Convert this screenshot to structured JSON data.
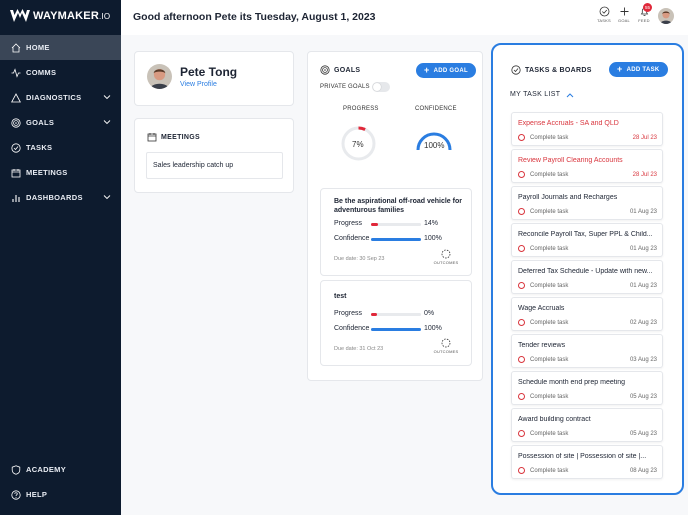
{
  "app": {
    "logo_text": "WAYMAKER",
    "logo_suffix": ".IO"
  },
  "sidebar": {
    "items": [
      {
        "label": "HOME",
        "icon": "home-icon",
        "active": true
      },
      {
        "label": "COMMS",
        "icon": "pulse-icon"
      },
      {
        "label": "DIAGNOSTICS",
        "icon": "triangle-icon",
        "expandable": true
      },
      {
        "label": "GOALS",
        "icon": "target-icon",
        "expandable": true
      },
      {
        "label": "TASKS",
        "icon": "check-circle-icon"
      },
      {
        "label": "MEETINGS",
        "icon": "calendar-icon"
      },
      {
        "label": "DASHBOARDS",
        "icon": "bar-chart-icon",
        "expandable": true
      }
    ],
    "bottom_items": [
      {
        "label": "ACADEMY",
        "icon": "shield-icon"
      },
      {
        "label": "HELP",
        "icon": "help-icon"
      }
    ]
  },
  "header": {
    "greeting": "Good afternoon Pete its Tuesday, August 1, 2023",
    "actions": [
      {
        "label": "TASKS",
        "icon": "task-check-icon"
      },
      {
        "label": "GOAL",
        "icon": "plus-icon"
      },
      {
        "label": "FEED",
        "icon": "bell-icon",
        "badge": "55"
      }
    ]
  },
  "profile": {
    "name": "Pete Tong",
    "link": "View Profile"
  },
  "meetings": {
    "title": "MEETINGS",
    "items": [
      "Sales leadership catch up"
    ]
  },
  "goals": {
    "title": "GOALS",
    "add_label": "ADD GOAL",
    "private_label": "PRIVATE GOALS",
    "progress_label": "PROGRESS",
    "confidence_label": "CONFIDENCE",
    "progress_value": "7%",
    "confidence_value": "100%",
    "progress_fraction": 0.07,
    "confidence_fraction": 1.0,
    "outcomes_label": "OUTCOMES",
    "progress_metric_label": "Progress",
    "confidence_metric_label": "Confidence",
    "items": [
      {
        "title": "Be the aspirational off-road vehicle for adventurous families",
        "progress": "14%",
        "progress_fraction": 0.14,
        "confidence": "100%",
        "confidence_fraction": 1.0,
        "due": "Due date: 30 Sep 23"
      },
      {
        "title": "test",
        "progress": "0%",
        "progress_fraction": 0.0,
        "confidence": "100%",
        "confidence_fraction": 1.0,
        "due": "Due date: 31 Oct 23"
      }
    ]
  },
  "tasks": {
    "title": "TASKS & BOARDS",
    "add_label": "ADD TASK",
    "list_title": "MY TASK LIST",
    "complete_label": "Complete task",
    "items": [
      {
        "name": "Expense Accruals - SA and QLD",
        "date": "28 Jul 23",
        "overdue": true
      },
      {
        "name": "Review Payroll Clearing Accounts",
        "date": "28 Jul 23",
        "overdue": true
      },
      {
        "name": "Payroll Journals and Recharges",
        "date": "01 Aug 23"
      },
      {
        "name": "Reconcile Payroll Tax, Super PPL & Child...",
        "date": "01 Aug 23"
      },
      {
        "name": "Deferred Tax Schedule - Update with new...",
        "date": "01 Aug 23"
      },
      {
        "name": "Wage Accruals",
        "date": "02 Aug 23"
      },
      {
        "name": "Tender reviews",
        "date": "03 Aug 23"
      },
      {
        "name": "Schedule month end prep meeting",
        "date": "05 Aug 23"
      },
      {
        "name": "Award building contract",
        "date": "05 Aug 23"
      },
      {
        "name": "Possession of site | Possession of site |...",
        "date": "08 Aug 23"
      }
    ]
  },
  "colors": {
    "sidebar_bg": "#0d1b2e",
    "accent": "#2a7de1",
    "danger": "#d9363e"
  }
}
